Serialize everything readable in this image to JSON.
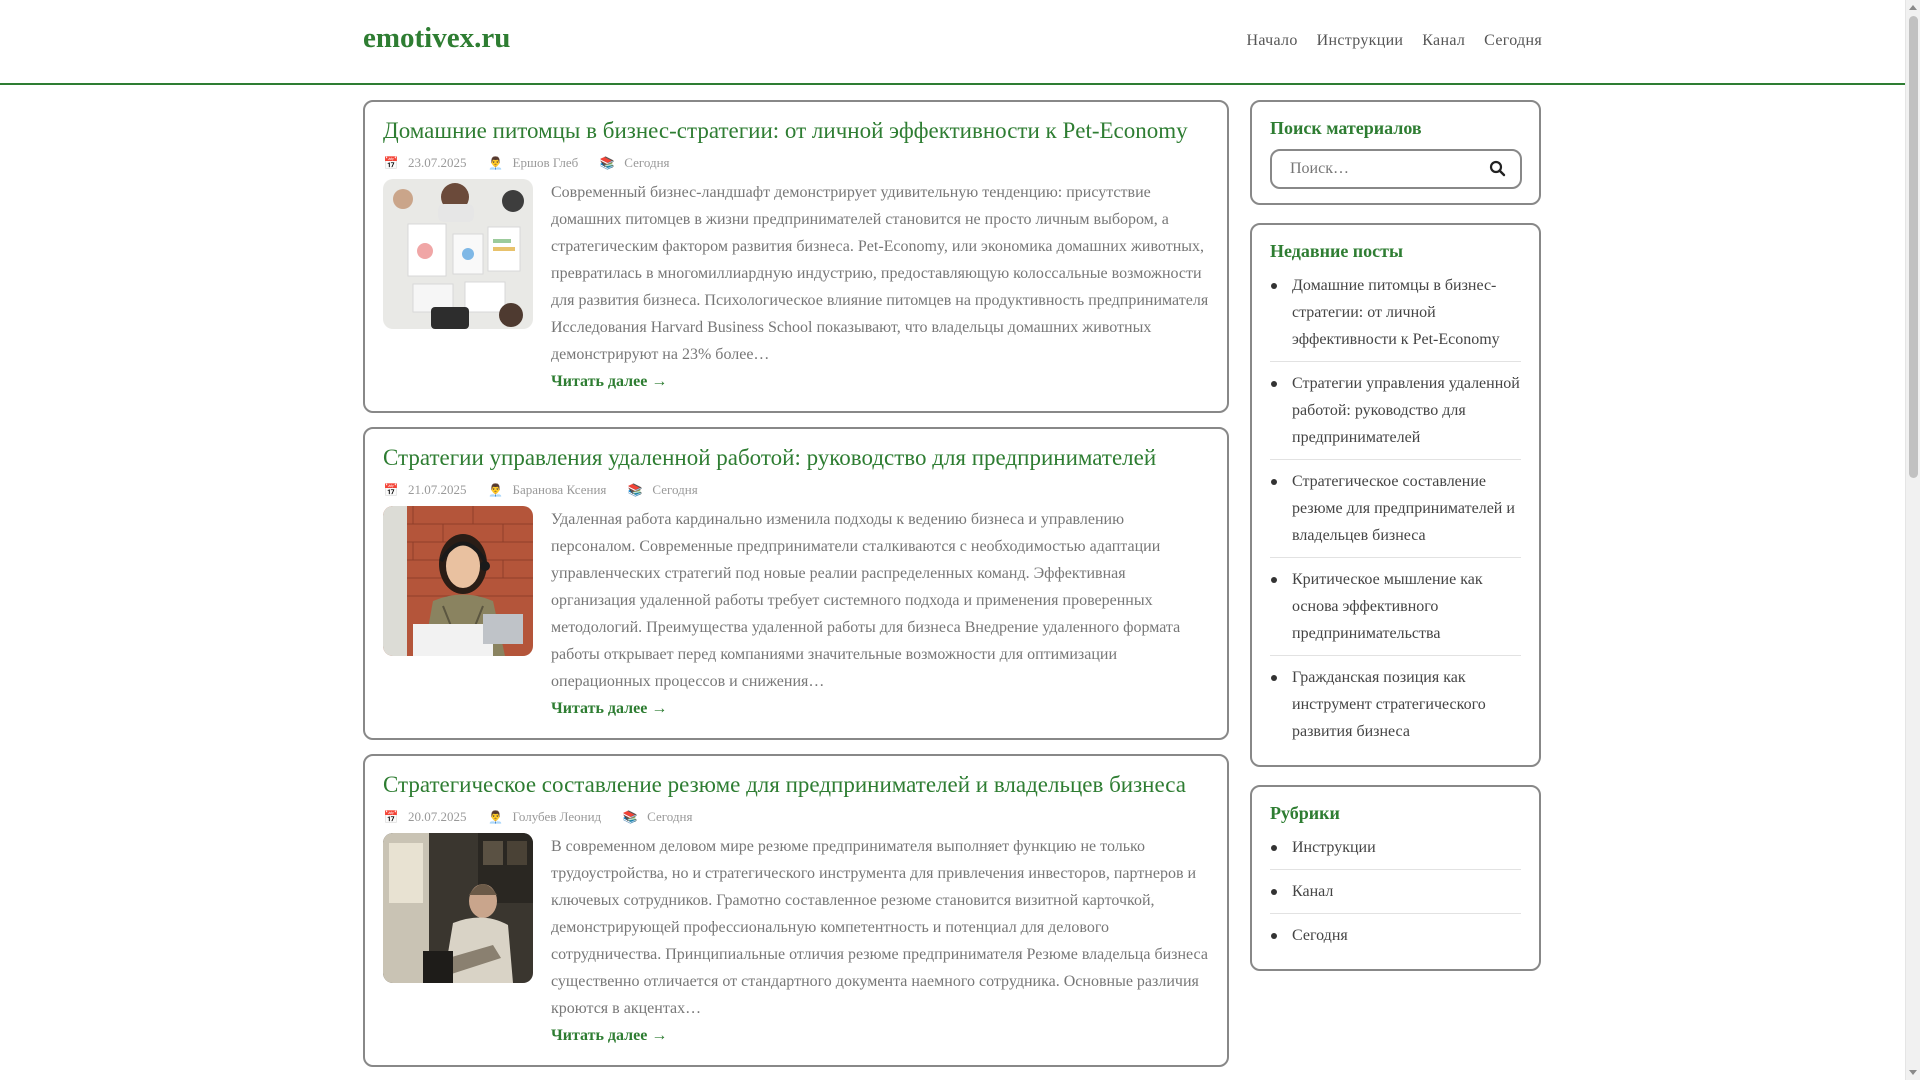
{
  "site": {
    "brand": "emotivex.ru",
    "nav": [
      "Начало",
      "Инструкции",
      "Канал",
      "Сегодня"
    ],
    "accent_color": "#2e7d32"
  },
  "posts": [
    {
      "title": "Домашние питомцы в бизнес-стратегии: от личной эффективности к Pet-Economy",
      "date": "23.07.2025",
      "author": "Ершов Глеб",
      "category": "Сегодня",
      "image": "office-meeting-overhead-photo",
      "excerpt": "Современный бизнес-ландшафт демонстрирует удивительную тенденцию: присутствие домашних питомцев в жизни предпринимателей становится не просто личным выбором, а стратегическим фактором развития бизнеса. Pet-Economy, или экономика домашних животных, превратилась в многомиллиардную индустрию, предоставляющую колоссальные возможности для развития бизнеса. Психологическое влияние питомцев на продуктивность предпринимателя Исследования Harvard Business School показывают, что владельцы домашних животных демонстрируют на 23% более…",
      "read_more": "Читать далее →"
    },
    {
      "title": "Стратегии управления удаленной работой: руководство для предпринимателей",
      "date": "21.07.2025",
      "author": "Баранова Ксения",
      "category": "Сегодня",
      "image": "woman-with-headset-photo",
      "excerpt": "Удаленная работа кардинально изменила подходы к ведению бизнеса и управлению персоналом. Современные предприниматели сталкиваются с необходимостью адаптации управленческих стратегий под новые реалии распределенных команд. Эффективная организация удаленной работы требует системного подхода и применения проверенных методологий. Преимущества удаленной работы для бизнеса Внедрение удаленного формата работы открывает перед компаниями значительные возможности для оптимизации операционных процессов и снижения…",
      "read_more": "Читать далее →"
    },
    {
      "title": "Стратегическое составление резюме для предпринимателей и владельцев бизнеса",
      "date": "20.07.2025",
      "author": "Голубев Леонид",
      "category": "Сегодня",
      "image": "man-in-office-chair-photo",
      "excerpt": "В современном деловом мире резюме предпринимателя выполняет функцию не только трудоустройства, но и стратегического инструмента для привлечения инвесторов, партнеров и ключевых сотрудников. Грамотно составленное резюме становится визитной карточкой, демонстрирующей профессиональную компетентность и потенциал для делового сотрудничества. Принципиальные отличия резюме предпринимателя Резюме владельца бизнеса существенно отличается от стандартного документа наемного сотрудника. Основные различия кроются в акцентах…",
      "read_more": "Читать далее →"
    }
  ],
  "sidebar": {
    "search": {
      "title": "Поиск материалов",
      "placeholder": "Поиск…"
    },
    "recent": {
      "title": "Недавние посты",
      "items": [
        "Домашние питомцы в бизнес-стратегии: от личной эффективности к Pet-Economy",
        "Стратегии управления удаленной работой: руководство для предпринимателей",
        "Стратегическое составление резюме для предпринимателей и владельцев бизнеса",
        "Критическое мышление как основа эффективного предпринимательства",
        "Гражданская позиция как инструмент стратегического развития бизнеса"
      ]
    },
    "categories": {
      "title": "Рубрики",
      "items": [
        "Инструкции",
        "Канал",
        "Сегодня"
      ]
    }
  }
}
